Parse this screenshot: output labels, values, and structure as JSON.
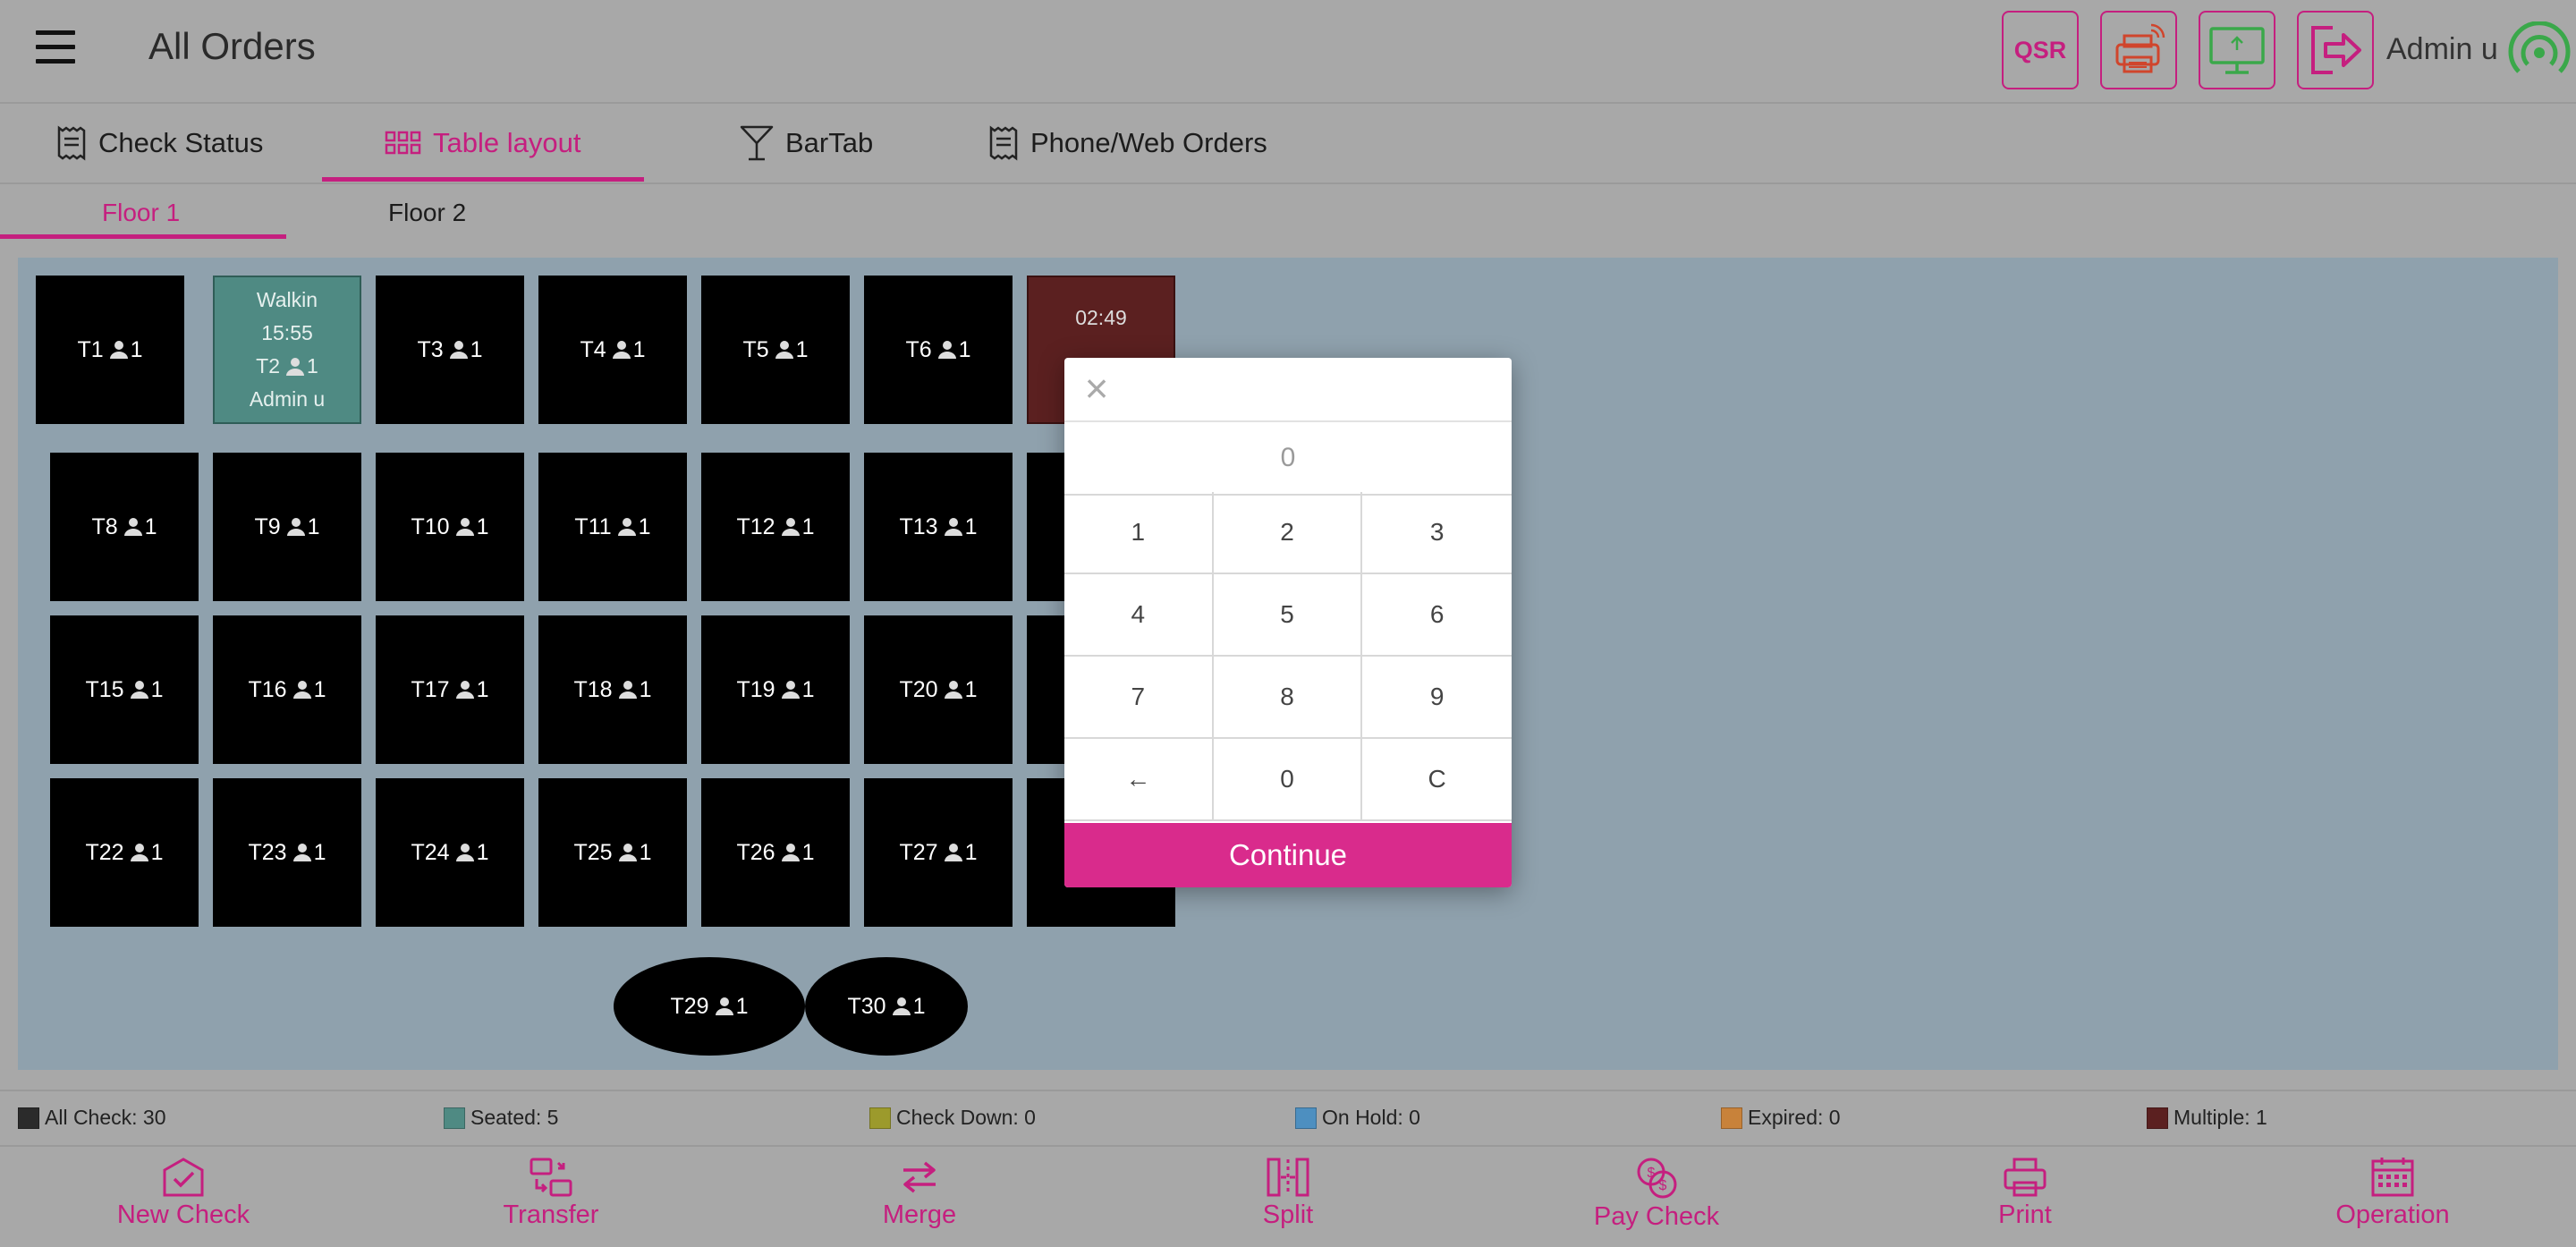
{
  "header": {
    "title": "All Orders",
    "qsr_label": "QSR",
    "admin_name": "Admin u",
    "accent": "#c51f7f"
  },
  "tabs": [
    {
      "label": "Check Status",
      "icon": "receipt-icon",
      "active": false
    },
    {
      "label": "Table layout",
      "icon": "grid-icon",
      "active": true
    },
    {
      "label": "BarTab",
      "icon": "cocktail-glass-icon",
      "active": false
    },
    {
      "label": "Phone/Web Orders",
      "icon": "receipt-icon",
      "active": false
    }
  ],
  "floors": [
    {
      "label": "Floor 1",
      "active": true
    },
    {
      "label": "Floor 2",
      "active": false
    }
  ],
  "tables": {
    "t1": {
      "name": "T1",
      "guests": "1"
    },
    "t2": {
      "name": "T2",
      "guests": "1",
      "status": "Walkin",
      "time": "15:55",
      "server": "Admin u"
    },
    "t3": {
      "name": "T3",
      "guests": "1"
    },
    "t4": {
      "name": "T4",
      "guests": "1"
    },
    "t5": {
      "name": "T5",
      "guests": "1"
    },
    "t6": {
      "name": "T6",
      "guests": "1"
    },
    "t7": {
      "time": "02:49"
    },
    "t8": {
      "name": "T8",
      "guests": "1"
    },
    "t9": {
      "name": "T9",
      "guests": "1"
    },
    "t10": {
      "name": "T10",
      "guests": "1"
    },
    "t11": {
      "name": "T11",
      "guests": "1"
    },
    "t12": {
      "name": "T12",
      "guests": "1"
    },
    "t13": {
      "name": "T13",
      "guests": "1"
    },
    "t15": {
      "name": "T15",
      "guests": "1"
    },
    "t16": {
      "name": "T16",
      "guests": "1"
    },
    "t17": {
      "name": "T17",
      "guests": "1"
    },
    "t18": {
      "name": "T18",
      "guests": "1"
    },
    "t19": {
      "name": "T19",
      "guests": "1"
    },
    "t20": {
      "name": "T20",
      "guests": "1"
    },
    "t22": {
      "name": "T22",
      "guests": "1"
    },
    "t23": {
      "name": "T23",
      "guests": "1"
    },
    "t24": {
      "name": "T24",
      "guests": "1"
    },
    "t25": {
      "name": "T25",
      "guests": "1"
    },
    "t26": {
      "name": "T26",
      "guests": "1"
    },
    "t27": {
      "name": "T27",
      "guests": "1"
    },
    "t29": {
      "name": "T29",
      "guests": "1"
    },
    "t30": {
      "name": "T30",
      "guests": "1"
    }
  },
  "dialog": {
    "close_glyph": "×",
    "display_value": "0",
    "keys": [
      "1",
      "2",
      "3",
      "4",
      "5",
      "6",
      "7",
      "8",
      "9",
      "←",
      "0",
      "C"
    ],
    "continue_label": "Continue"
  },
  "legend": [
    {
      "label": "All Check: 30",
      "color": "#2b2b2b"
    },
    {
      "label": "Seated: 5",
      "color": "#4f8a83"
    },
    {
      "label": "Check Down: 0",
      "color": "#9c9a2c"
    },
    {
      "label": "On Hold: 0",
      "color": "#4d8fc0"
    },
    {
      "label": "Expired: 0",
      "color": "#c8823a"
    },
    {
      "label": "Multiple: 1",
      "color": "#5b2020"
    }
  ],
  "bottom_actions": [
    {
      "label": "New Check",
      "icon": "new-check-icon"
    },
    {
      "label": "Transfer",
      "icon": "transfer-icon"
    },
    {
      "label": "Merge",
      "icon": "merge-icon"
    },
    {
      "label": "Split",
      "icon": "split-icon"
    },
    {
      "label": "Pay Check",
      "icon": "pay-check-icon"
    },
    {
      "label": "Print",
      "icon": "printer-icon"
    },
    {
      "label": "Operation",
      "icon": "calendar-icon"
    }
  ]
}
